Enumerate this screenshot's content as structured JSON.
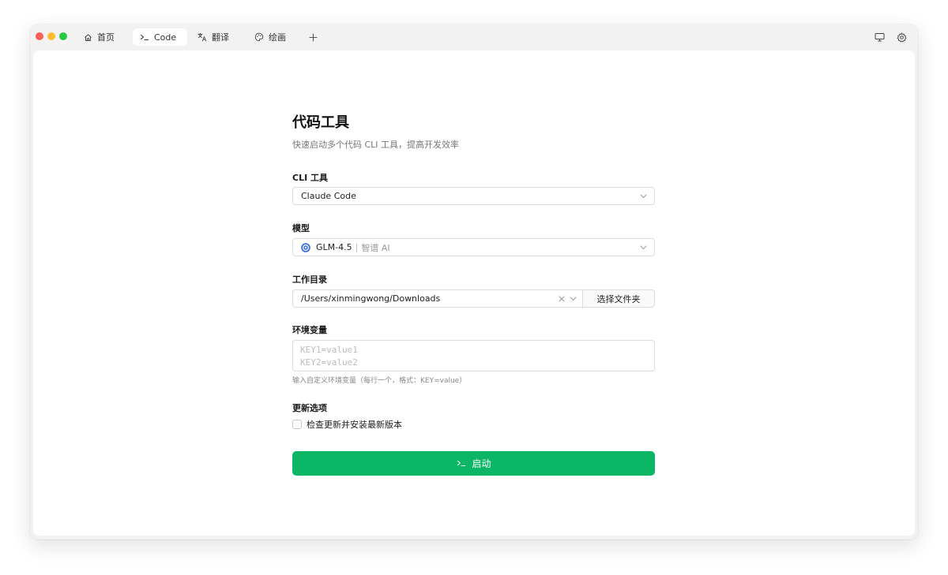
{
  "tabs": [
    {
      "label": "首页",
      "icon": "home-icon"
    },
    {
      "label": "Code",
      "icon": "terminal-icon",
      "active": true
    },
    {
      "label": "翻译",
      "icon": "translate-icon"
    },
    {
      "label": "绘画",
      "icon": "palette-icon"
    }
  ],
  "page": {
    "title": "代码工具",
    "subtitle": "快速启动多个代码 CLI 工具，提高开发效率"
  },
  "cli_tool": {
    "label": "CLI 工具",
    "value": "Claude Code"
  },
  "model": {
    "label": "模型",
    "name": "GLM-4.5",
    "separator": "|",
    "provider": "智谱 AI"
  },
  "workdir": {
    "label": "工作目录",
    "value": "/Users/xinmingwong/Downloads",
    "browse_label": "选择文件夹"
  },
  "env": {
    "label": "环境变量",
    "placeholder_lines": [
      "KEY1=value1",
      "KEY2=value2"
    ],
    "hint": "输入自定义环境变量（每行一个，格式：KEY=value）"
  },
  "update": {
    "label": "更新选项",
    "checkbox_label": "检查更新并安装最新版本",
    "checked": false
  },
  "launch": {
    "label": "启动"
  },
  "colors": {
    "accent": "#0bb765",
    "traffic_red": "#fe5f57",
    "traffic_yellow": "#febc2e",
    "traffic_green": "#28c840"
  }
}
